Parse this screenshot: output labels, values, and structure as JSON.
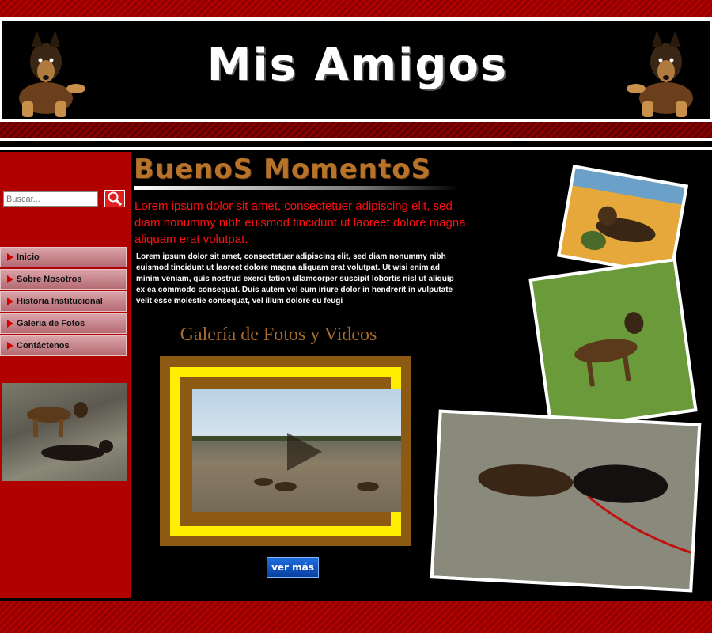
{
  "header": {
    "title": "Mis Amigos"
  },
  "search": {
    "placeholder": "Buscar..."
  },
  "nav": {
    "items": [
      {
        "label": "Inicio"
      },
      {
        "label": "Sobre Nosotros"
      },
      {
        "label": "Historia Institucional"
      },
      {
        "label": "Galería de Fotos"
      },
      {
        "label": "Contáctenos"
      }
    ]
  },
  "main": {
    "section_title": "BuenoS MomentoS",
    "lead": "Lorem ipsum dolor sit amet, consectetuer adipiscing elit, sed diam nonummy nibh euismod tincidunt ut laoreet dolore magna aliquam erat volutpat.",
    "body": "Lorem ipsum dolor sit amet, consectetuer adipiscing elit, sed diam nonummy nibh euismod tincidunt ut laoreet dolore magna aliquam erat volutpat. Ut wisi enim ad minim veniam, quis nostrud exerci tation ullamcorper suscipit lobortis nisl ut aliquip ex ea commodo consequat. Duis autem vel eum iriure dolor in hendrerit in vulputate velit esse molestie consequat, vel illum dolore eu feugi",
    "gallery_heading": "Galería de Fotos y Videos",
    "more_button": "ver más"
  },
  "colors": {
    "brand_red": "#b00000",
    "title_brown": "#b8732a",
    "lead_red": "#ff1010",
    "frame_yellow": "#ffee00"
  }
}
